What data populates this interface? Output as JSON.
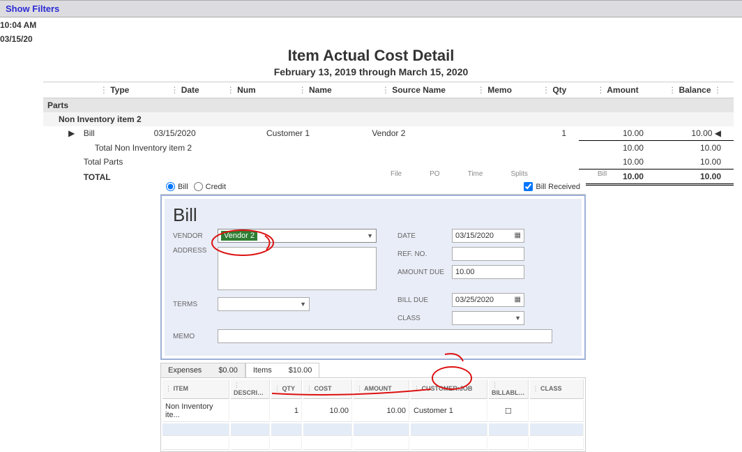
{
  "header": {
    "show_filters": "Show Filters",
    "time": "10:04 AM",
    "date": "03/15/20"
  },
  "report": {
    "title": "Item Actual Cost Detail",
    "subtitle": "February 13, 2019 through March 15, 2020",
    "columns": [
      "Type",
      "Date",
      "Num",
      "Name",
      "Source Name",
      "Memo",
      "Qty",
      "Amount",
      "Balance"
    ],
    "group1": "Parts",
    "subgroup1": "Non Inventory item 2",
    "rows": [
      {
        "type": "Bill",
        "date": "03/15/2020",
        "num": "",
        "name": "Customer 1",
        "source": "Vendor 2",
        "memo": "",
        "qty": "1",
        "amount": "10.00",
        "balance": "10.00"
      }
    ],
    "total_sub_label": "Total Non Inventory item 2",
    "total_sub_amount": "10.00",
    "total_sub_balance": "10.00",
    "total_group_label": "Total Parts",
    "total_group_amount": "10.00",
    "total_group_balance": "10.00",
    "grand_label": "TOTAL",
    "grand_amount": "10.00",
    "grand_balance": "10.00"
  },
  "bill_panel": {
    "tabs_hint": [
      "File",
      "PO",
      "Time",
      "Splits",
      "Bill"
    ],
    "radio_bill": "Bill",
    "radio_credit": "Credit",
    "received_label": "Bill Received",
    "title": "Bill",
    "vendor_label": "VENDOR",
    "vendor_value": "Vendor 2",
    "address_label": "ADDRESS",
    "terms_label": "TERMS",
    "memo_label": "MEMO",
    "date_label": "DATE",
    "date_value": "03/15/2020",
    "refno_label": "REF. NO.",
    "amountdue_label": "AMOUNT DUE",
    "amountdue_value": "10.00",
    "billdue_label": "BILL DUE",
    "billdue_value": "03/25/2020",
    "class_label": "CLASS",
    "expenses_tab": "Expenses",
    "expenses_amount": "$0.00",
    "items_tab": "Items",
    "items_amount": "$10.00",
    "grid_cols": [
      "ITEM",
      "DESCRI…",
      "QTY",
      "COST",
      "AMOUNT",
      "CUSTOMER:JOB",
      "BILLABL…",
      "CLASS"
    ],
    "grid_row": {
      "item": "Non Inventory ite...",
      "descr": "",
      "qty": "1",
      "cost": "10.00",
      "amount": "10.00",
      "cust": "Customer 1",
      "billable": "☐",
      "class": ""
    }
  }
}
